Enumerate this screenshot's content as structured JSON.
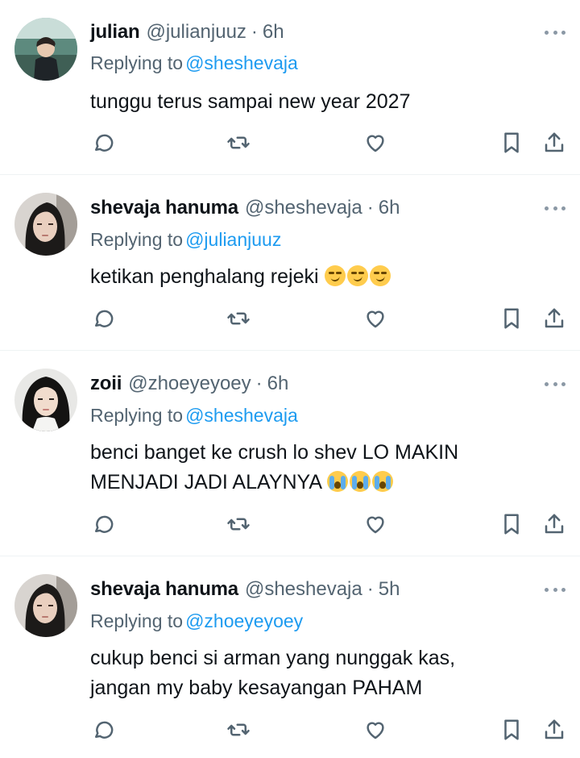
{
  "replying_label": "Replying to",
  "tweets": [
    {
      "name": "julian",
      "handle": "@julianjuuz",
      "time": "6h",
      "replying_to": "@sheshevaja",
      "text_lines": [
        "tunggu terus sampai new year 2027"
      ],
      "emoji": []
    },
    {
      "name": "shevaja hanuma",
      "handle": "@sheshevaja",
      "time": "6h",
      "replying_to": "@julianjuuz",
      "text_lines": [
        "ketikan penghalang rejeki"
      ],
      "emoji": [
        "smirking-face",
        "smirking-face",
        "smirking-face"
      ]
    },
    {
      "name": "zoii",
      "handle": "@zhoeyeyoey",
      "time": "6h",
      "replying_to": "@sheshevaja",
      "text_lines": [
        "benci banget ke crush lo shev LO MAKIN",
        "MENJADI JADI ALAYNYA"
      ],
      "emoji": [
        "loudly-crying-face",
        "loudly-crying-face",
        "loudly-crying-face"
      ]
    },
    {
      "name": "shevaja hanuma",
      "handle": "@sheshevaja",
      "time": "5h",
      "replying_to": "@zhoeyeyoey",
      "text_lines": [
        "cukup benci si arman yang nunggak kas,",
        "jangan my baby kesayangan PAHAM"
      ],
      "emoji": []
    }
  ],
  "icons": {
    "reply": "speech-bubble-icon",
    "retweet": "retweet-arrows-icon",
    "like": "heart-icon",
    "bookmark": "bookmark-icon",
    "share": "share-upload-icon",
    "more": "more-dots-icon"
  },
  "colors": {
    "link": "#1d9bf0",
    "secondary_text": "#536471",
    "primary_text": "#0f1419",
    "separator": "#eff3f4"
  }
}
